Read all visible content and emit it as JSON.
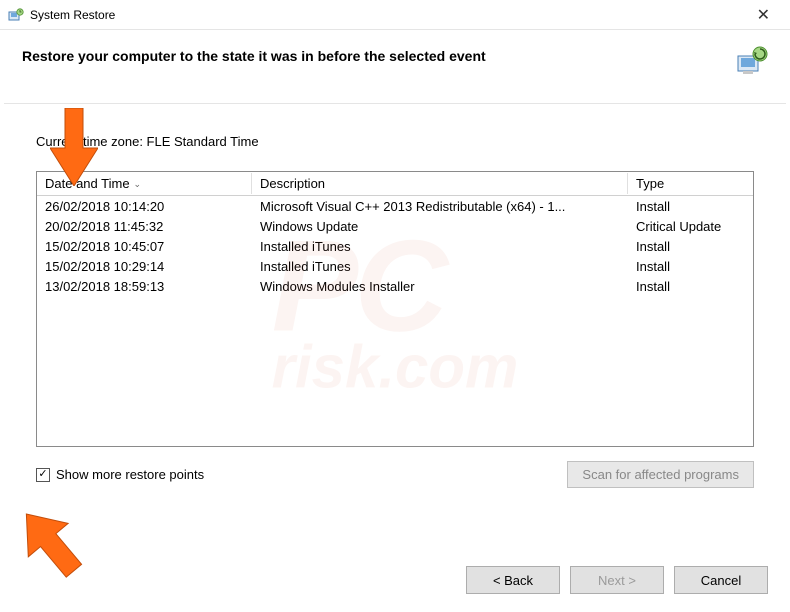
{
  "window": {
    "title": "System Restore"
  },
  "header": {
    "heading": "Restore your computer to the state it was in before the selected event"
  },
  "timezone_label": "Current time zone: FLE Standard Time",
  "columns": {
    "date": "Date and Time",
    "desc": "Description",
    "type": "Type"
  },
  "rows": [
    {
      "date": "26/02/2018 10:14:20",
      "desc": "Microsoft Visual C++ 2013 Redistributable (x64) - 1...",
      "type": "Install"
    },
    {
      "date": "20/02/2018 11:45:32",
      "desc": "Windows Update",
      "type": "Critical Update"
    },
    {
      "date": "15/02/2018 10:45:07",
      "desc": "Installed iTunes",
      "type": "Install"
    },
    {
      "date": "15/02/2018 10:29:14",
      "desc": "Installed iTunes",
      "type": "Install"
    },
    {
      "date": "13/02/2018 18:59:13",
      "desc": "Windows Modules Installer",
      "type": "Install"
    }
  ],
  "checkbox": {
    "label": "Show more restore points",
    "checked": true
  },
  "scan_button": "Scan for affected programs",
  "buttons": {
    "back": "< Back",
    "next": "Next >",
    "cancel": "Cancel"
  },
  "watermark": {
    "main": "PC",
    "sub": "risk.com"
  }
}
